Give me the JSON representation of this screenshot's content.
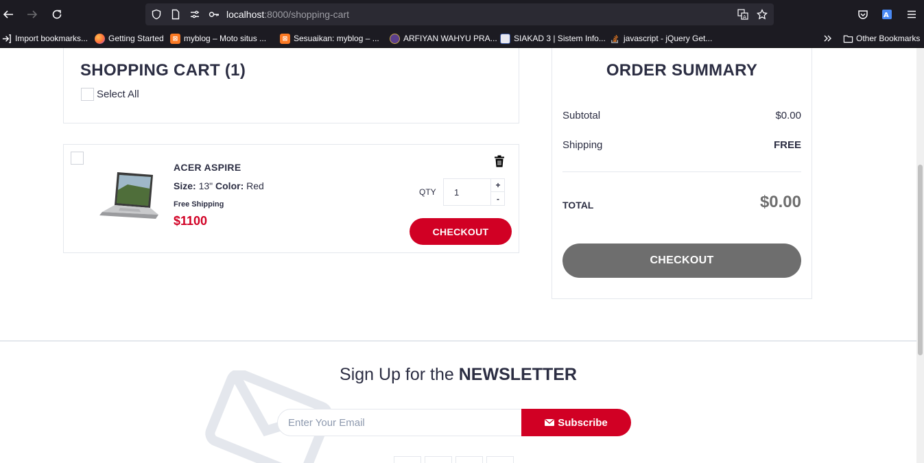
{
  "browser": {
    "url_host": "localhost",
    "url_path": ":8000/shopping-cart",
    "bookmarks": [
      {
        "label": "Import bookmarks...",
        "icon": "import-icon"
      },
      {
        "label": "Getting Started",
        "icon": "firefox-icon"
      },
      {
        "label": "myblog – Moto situs ...",
        "icon": "blog-icon"
      },
      {
        "label": "Sesuaikan: myblog – ...",
        "icon": "blog-icon"
      },
      {
        "label": "ARFIYAN WAHYU PRA...",
        "icon": "seal-icon"
      },
      {
        "label": "SIAKAD 3 | Sistem Info...",
        "icon": "siakad-icon"
      },
      {
        "label": "javascript - jQuery Get...",
        "icon": "stackoverflow-icon"
      }
    ],
    "other_bookmarks": "Other Bookmarks"
  },
  "cart": {
    "title": "SHOPPING CART (1)",
    "select_all": "Select All",
    "item": {
      "name": "ACER ASPIRE",
      "size_label": "Size:",
      "size_value": "13\"",
      "color_label": "Color:",
      "color_value": "Red",
      "shipping": "Free Shipping",
      "price": "$1100",
      "qty_label": "QTY",
      "qty_value": "1",
      "qty_plus": "+",
      "qty_minus": "-",
      "checkout_label": "CHECKOUT"
    }
  },
  "summary": {
    "title": "ORDER SUMMARY",
    "subtotal_label": "Subtotal",
    "subtotal_value": "$0.00",
    "shipping_label": "Shipping",
    "shipping_value": "FREE",
    "total_label": "TOTAL",
    "total_value": "$0.00",
    "checkout_label": "CHECKOUT"
  },
  "newsletter": {
    "title_prefix": "Sign Up for the ",
    "title_bold": "NEWSLETTER",
    "email_placeholder": "Enter Your Email",
    "subscribe_label": "Subscribe"
  },
  "colors": {
    "accent_red": "#D10024",
    "text_dark": "#2B2D42",
    "disabled_grey": "#6E6E6E",
    "chrome_bg": "#1C1B22"
  }
}
